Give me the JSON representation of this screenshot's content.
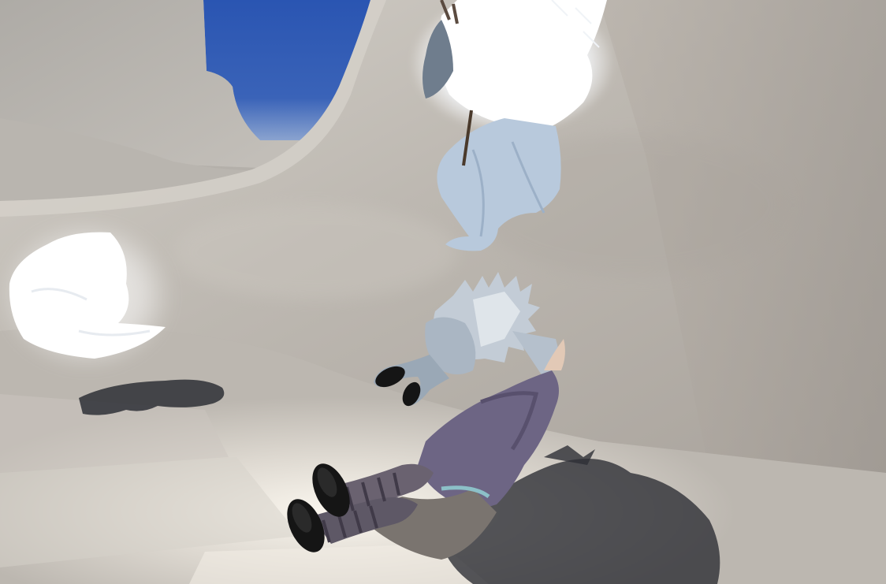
{
  "scene": {
    "kind": "3d-game-viewport",
    "hud_text": [],
    "colors": {
      "sky_deep": "#2a55b2",
      "sky_light": "#8aa3cf",
      "sand_light": "#dcd8d2",
      "sand_mid": "#c0bbb4",
      "sand_dark": "#9d9892",
      "shadow": "#2e3036",
      "glow_white": "#ffffff",
      "ice_blue": "#b8c9dc",
      "cloak_purple": "#6d6584",
      "boot_black": "#151515"
    },
    "objects": [
      "sky",
      "half-pipe-ramp",
      "sand-floor",
      "glowing-crystal-orb",
      "ice-creature-upper",
      "spiky-creature-center",
      "fallen-warrior",
      "ground-shadows"
    ]
  }
}
